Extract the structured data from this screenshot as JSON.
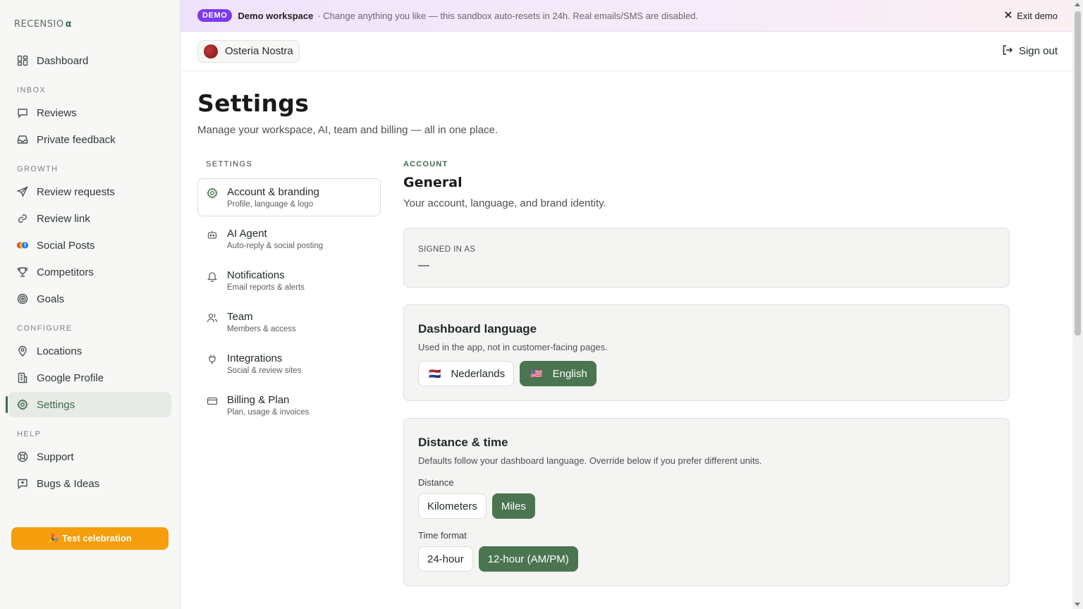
{
  "brand": {
    "logo_text": "RECENSIO",
    "logo_mark": "α"
  },
  "sidebar": {
    "items": [
      {
        "label": "Dashboard",
        "icon": "dashboard-icon"
      },
      {
        "section": "INBOX"
      },
      {
        "label": "Reviews",
        "icon": "message-icon"
      },
      {
        "label": "Private feedback",
        "icon": "inbox-icon"
      },
      {
        "section": "GROWTH"
      },
      {
        "label": "Review requests",
        "icon": "send-icon"
      },
      {
        "label": "Review link",
        "icon": "link-icon"
      },
      {
        "label": "Social Posts",
        "icon": "social-icon"
      },
      {
        "label": "Competitors",
        "icon": "trophy-icon"
      },
      {
        "label": "Goals",
        "icon": "target-icon"
      },
      {
        "section": "CONFIGURE"
      },
      {
        "label": "Locations",
        "icon": "pin-icon"
      },
      {
        "label": "Google Profile",
        "icon": "building-icon"
      },
      {
        "label": "Settings",
        "icon": "gear-icon",
        "active": true
      },
      {
        "section": "HELP"
      },
      {
        "label": "Support",
        "icon": "lifebuoy-icon"
      },
      {
        "label": "Bugs & Ideas",
        "icon": "feedback-icon"
      }
    ],
    "test_button": "🎉 Test celebration"
  },
  "banner": {
    "badge": "DEMO",
    "title": "Demo workspace",
    "text": "· Change anything you like — this sandbox auto-resets in 24h. Real emails/SMS are disabled.",
    "exit": "Exit demo"
  },
  "topbar": {
    "location": "Osteria Nostra",
    "sign_out": "Sign out"
  },
  "page": {
    "title": "Settings",
    "subtitle": "Manage your workspace, AI, team and billing — all in one place."
  },
  "settings_nav": {
    "heading": "SETTINGS",
    "items": [
      {
        "label": "Account & branding",
        "desc": "Profile, language & logo",
        "icon": "gear-icon",
        "active": true
      },
      {
        "label": "AI Agent",
        "desc": "Auto-reply & social posting",
        "icon": "robot-icon"
      },
      {
        "label": "Notifications",
        "desc": "Email reports & alerts",
        "icon": "bell-icon"
      },
      {
        "label": "Team",
        "desc": "Members & access",
        "icon": "users-icon"
      },
      {
        "label": "Integrations",
        "desc": "Social & review sites",
        "icon": "plug-icon"
      },
      {
        "label": "Billing & Plan",
        "desc": "Plan, usage & invoices",
        "icon": "card-icon"
      }
    ]
  },
  "panel": {
    "eyebrow": "ACCOUNT",
    "title": "General",
    "subtitle": "Your account, language, and brand identity.",
    "signed_in": {
      "label": "SIGNED IN AS",
      "value": "—"
    },
    "language": {
      "title": "Dashboard language",
      "subtitle": "Used in the app, not in customer-facing pages.",
      "options": [
        {
          "flag": "🇳🇱",
          "label": "Nederlands",
          "selected": false
        },
        {
          "flag": "🇺🇸",
          "label": "English",
          "selected": true
        }
      ]
    },
    "distance_time": {
      "title": "Distance & time",
      "subtitle": "Defaults follow your dashboard language. Override below if you prefer different units.",
      "distance_label": "Distance",
      "distance_options": [
        {
          "label": "Kilometers",
          "selected": false
        },
        {
          "label": "Miles",
          "selected": true
        }
      ],
      "time_label": "Time format",
      "time_options": [
        {
          "label": "24-hour",
          "selected": false
        },
        {
          "label": "12-hour (AM/PM)",
          "selected": true
        }
      ]
    }
  },
  "colors": {
    "accent": "#4a7550",
    "demo_badge": "#7c3aed",
    "test_button": "#f59e0b"
  }
}
